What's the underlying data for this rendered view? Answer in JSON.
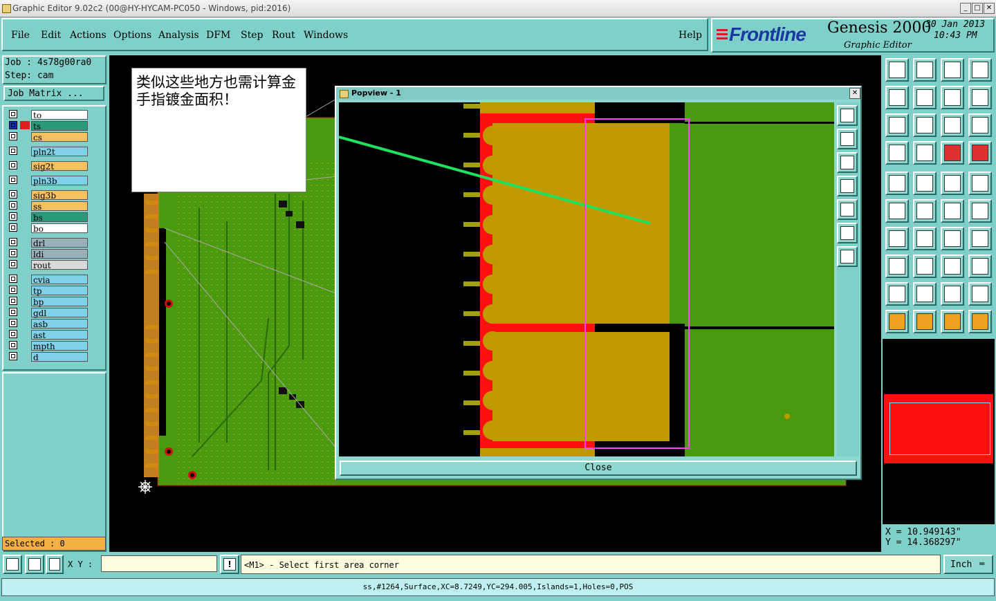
{
  "window": {
    "title": "Graphic Editor 9.02c2 (00@HY-HYCAM-PC050 - Windows, pid:2016)",
    "min": "_",
    "max": "□",
    "close": "✕"
  },
  "menu": [
    "File",
    "Edit",
    "Actions",
    "Options",
    "Analysis",
    "DFM",
    "Step",
    "Rout",
    "Windows"
  ],
  "help_label": "Help",
  "brand": {
    "logo": "Frontline",
    "product": "Genesis 2000",
    "subtitle": "Graphic Editor",
    "date": "30 Jan 2013",
    "time": "10:43 PM"
  },
  "job": {
    "label": "Job : 4s78g00ra0",
    "step": "Step: cam",
    "matrix_button": "Job Matrix ..."
  },
  "layers": [
    {
      "name": "to",
      "color": "#ffffff"
    },
    {
      "name": "ts",
      "color": "#2a9a7a"
    },
    {
      "name": "cs",
      "color": "#f4c060"
    },
    {
      "name": "pln2t",
      "color": "#80d0e8"
    },
    {
      "name": "sig2t",
      "color": "#f4c060"
    },
    {
      "name": "pln3b",
      "color": "#80d0e8"
    },
    {
      "name": "sig3b",
      "color": "#f4c060"
    },
    {
      "name": "ss",
      "color": "#f4c060"
    },
    {
      "name": "bs",
      "color": "#2a9a7a"
    },
    {
      "name": "bo",
      "color": "#ffffff"
    },
    {
      "name": "drl",
      "color": "#9ab0b8"
    },
    {
      "name": "ldi",
      "color": "#9ab0b8"
    },
    {
      "name": "rout",
      "color": "#d8d8d8"
    },
    {
      "name": "cvia",
      "color": "#80d0e8"
    },
    {
      "name": "tp",
      "color": "#80d0e8"
    },
    {
      "name": "bp",
      "color": "#80d0e8"
    },
    {
      "name": "gdl",
      "color": "#80d0e8"
    },
    {
      "name": "asb",
      "color": "#80d0e8"
    },
    {
      "name": "ast",
      "color": "#80d0e8"
    },
    {
      "name": "mpth",
      "color": "#80d0e8"
    },
    {
      "name": "d",
      "color": "#80d0e8"
    }
  ],
  "selected_text": "Selected : 0",
  "annotation": "类似这些地方也需计算金手指镀金面积！",
  "popview": {
    "title": "Popview - 1",
    "close_button": "Close"
  },
  "coords": {
    "x": "X  =  10.949143\"",
    "y": "Y  =  14.368297\""
  },
  "xy_label": "X Y :",
  "xy_value": "",
  "prompt": "<M1> - Select first area corner",
  "unit": "Inch",
  "status": "ss,#1264,Surface,XC=8.7249,YC=294.005,Islands=1,Holes=0,POS"
}
